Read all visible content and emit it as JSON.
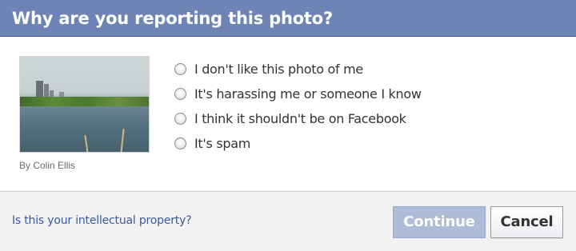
{
  "dialog": {
    "title": "Why are you reporting this photo?"
  },
  "photo": {
    "alt": "Reported photo of a lake with a city skyline",
    "credit": "By Colin Ellis"
  },
  "options": [
    {
      "label": "I don't like this photo of me",
      "selected": false
    },
    {
      "label": "It's harassing me or someone I know",
      "selected": false
    },
    {
      "label": "I think it shouldn't be on Facebook",
      "selected": false
    },
    {
      "label": "It's spam",
      "selected": false
    }
  ],
  "footer": {
    "ip_link": "Is this your intellectual property?",
    "continue_label": "Continue",
    "cancel_label": "Cancel"
  },
  "colors": {
    "header": "#6d84b4",
    "link": "#3b5998",
    "continue_disabled": "#aebcd8"
  }
}
